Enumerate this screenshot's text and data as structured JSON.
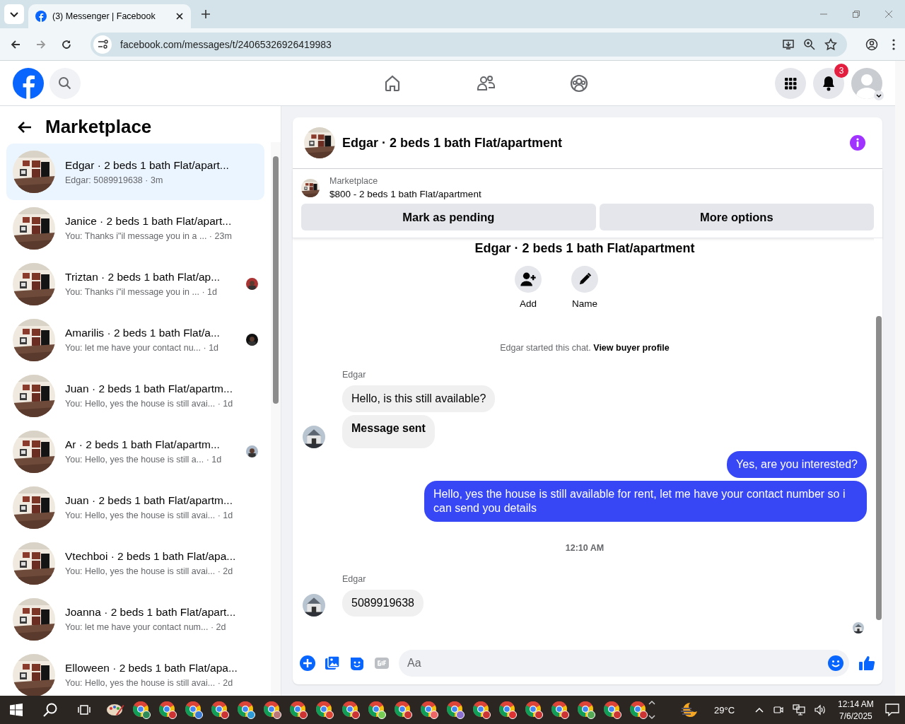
{
  "browser": {
    "tab_title": "(3) Messenger | Facebook",
    "url": "facebook.com/messages/t/24065326926419983"
  },
  "topbar": {
    "nav": [
      {
        "kind": "home",
        "selected": false
      },
      {
        "kind": "friends",
        "selected": false
      },
      {
        "kind": "groups",
        "selected": false
      }
    ],
    "notification_count": "3"
  },
  "sidebar": {
    "title": "Marketplace",
    "conversations": [
      {
        "name": "Edgar · 2 beds 1 bath Flat/apart...",
        "preview": "Edgar: 5089919638 · 3m",
        "selected": true,
        "seen": false
      },
      {
        "name": "Janice · 2 beds 1 bath Flat/apart...",
        "preview": "You: Thanks i\"il message you in a ... · 23m",
        "selected": false,
        "seen": false
      },
      {
        "name": "Triztan · 2 beds 1 bath Flat/ap...",
        "preview": "You: Thanks i\"il message you in ...  · 1d",
        "selected": false,
        "seen": true
      },
      {
        "name": "Amarilis · 2 beds 1 bath Flat/a...",
        "preview": "You: let me have your contact nu... · 1d",
        "selected": false,
        "seen": true
      },
      {
        "name": "Juan · 2 beds 1 bath Flat/apartm...",
        "preview": "You: Hello, yes the house is still avai... · 1d",
        "selected": false,
        "seen": false
      },
      {
        "name": "Ar · 2 beds 1 bath Flat/apartm...",
        "preview": "You: Hello, yes the house is still a... · 1d",
        "selected": false,
        "seen": true
      },
      {
        "name": "Juan · 2 beds 1 bath Flat/apartm...",
        "preview": "You: Hello, yes the house is still avai... · 1d",
        "selected": false,
        "seen": false
      },
      {
        "name": "Vtechboi · 2 beds 1 bath Flat/apa...",
        "preview": "You: Hello, yes the house is still avai... · 2d",
        "selected": false,
        "seen": false
      },
      {
        "name": "Joanna · 2 beds 1 bath Flat/apart...",
        "preview": "You: let me have your contact num...  · 2d",
        "selected": false,
        "seen": false
      },
      {
        "name": "Elloween · 2 beds 1 bath Flat/apa...",
        "preview": "You: Hello, yes the house is still avai... · 2d",
        "selected": false,
        "seen": false
      }
    ]
  },
  "chat": {
    "title": "Edgar · 2 beds 1 bath Flat/apartment",
    "listing": {
      "source": "Marketplace",
      "item": "$800 - 2 beds 1 bath Flat/apartment"
    },
    "actions": [
      "Mark as pending",
      "More options"
    ],
    "intro": {
      "title": "Edgar · 2 beds 1 bath Flat/apartment",
      "buttons": [
        {
          "kind": "add",
          "label": "Add"
        },
        {
          "kind": "name",
          "label": "Name"
        }
      ],
      "note": "Edgar started this chat. **View buyer profile**"
    },
    "messages": [
      {
        "kind": "sender",
        "text": "Edgar"
      },
      {
        "kind": "incoming",
        "text": "Hello, is this still available?",
        "bold": false,
        "avatar": false
      },
      {
        "kind": "incoming",
        "text": "Message sent",
        "bold": true,
        "avatar": true
      },
      {
        "kind": "outgoing",
        "text": "Yes, are you interested?"
      },
      {
        "kind": "outgoing",
        "text": "Hello, yes the house is still available for rent, let me have your contact number so i can send you details"
      },
      {
        "kind": "time",
        "text": "12:10 AM"
      },
      {
        "kind": "sender",
        "text": "Edgar"
      },
      {
        "kind": "incoming",
        "text": "5089919638",
        "bold": false,
        "avatar": true
      },
      {
        "kind": "seen"
      }
    ],
    "composer": {
      "placeholder": "Aa"
    }
  },
  "taskbar": {
    "apps": [
      {
        "kind": "paint"
      },
      {
        "kind": "browser"
      },
      {
        "kind": "browser"
      },
      {
        "kind": "browser"
      },
      {
        "kind": "browser"
      },
      {
        "kind": "browser"
      },
      {
        "kind": "browser"
      },
      {
        "kind": "browser"
      },
      {
        "kind": "browser"
      },
      {
        "kind": "browser"
      },
      {
        "kind": "browser"
      },
      {
        "kind": "browser"
      },
      {
        "kind": "browser"
      },
      {
        "kind": "browser"
      },
      {
        "kind": "browser"
      },
      {
        "kind": "browser"
      },
      {
        "kind": "browser"
      },
      {
        "kind": "browser"
      },
      {
        "kind": "browser"
      },
      {
        "kind": "browser"
      },
      {
        "kind": "browser"
      }
    ],
    "weather": "29°C",
    "time": "12:14 AM",
    "date": "7/6/2025"
  }
}
